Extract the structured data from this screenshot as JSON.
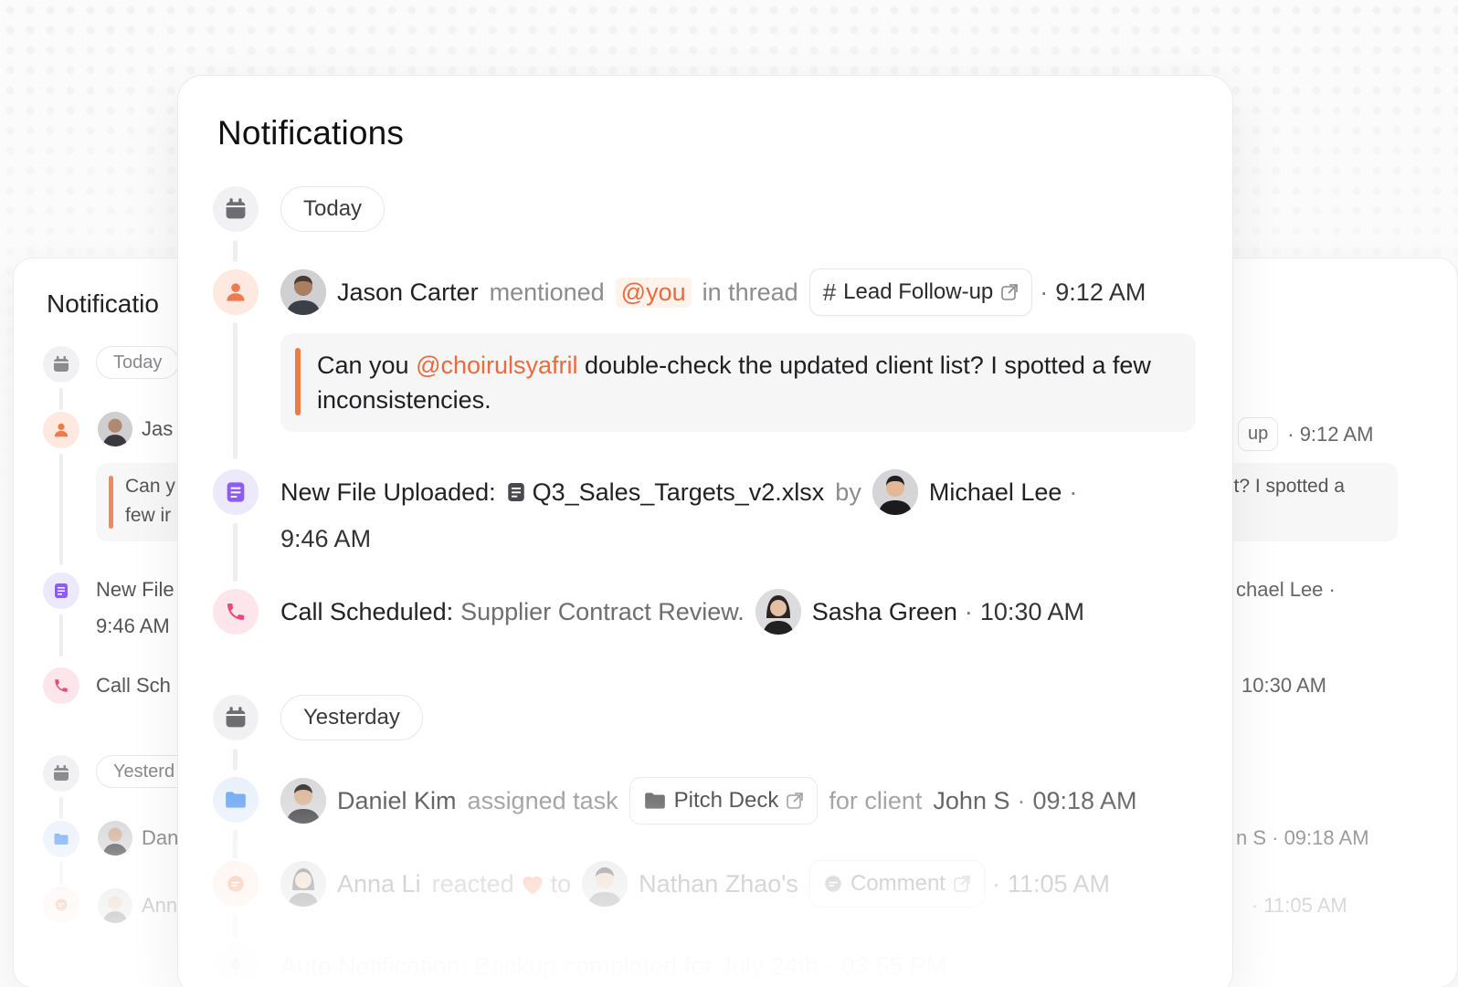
{
  "panel": {
    "title": "Notifications",
    "groups": [
      {
        "label": "Today"
      },
      {
        "label": "Yesterday"
      }
    ]
  },
  "notifications": {
    "mention": {
      "user": "Jason Carter",
      "action": "mentioned",
      "target": "@you",
      "context": "in thread",
      "tag": "Lead Follow-up",
      "time": "9:12 AM",
      "quote_prefix": "Can you ",
      "quote_mention": "@choirulsyafril",
      "quote_text": " double-check the updated client list? I spotted a few inconsistencies."
    },
    "file": {
      "label": "New File Uploaded:",
      "file_name": "Q3_Sales_Targets_v2.xlsx",
      "by": "by",
      "user": "Michael Lee",
      "time": "9:46 AM"
    },
    "call": {
      "label": "Call Scheduled:",
      "subject": "Supplier Contract Review.",
      "user": "Sasha Green",
      "time": "10:30 AM"
    },
    "task": {
      "user": "Daniel Kim",
      "action": "assigned task",
      "tag": "Pitch Deck",
      "for_client": "for client",
      "client": "John S",
      "time": "09:18 AM"
    },
    "reaction": {
      "user": "Anna Li",
      "action": "reacted",
      "to": "to",
      "target_user": "Nathan Zhao's",
      "tag": "Comment",
      "time": "11:05 AM"
    },
    "auto": {
      "label": "Auto Notification:",
      "text": "Backup completed for July 24th",
      "time": "03:55 PM"
    }
  },
  "back_panel": {
    "title": "Notificatio",
    "today": "Today",
    "yesterday": "Yesterd",
    "jason": "Jas",
    "quote_l1": "Can y",
    "quote_l2": "few ir",
    "file": "New File",
    "file_time": "9:46 AM",
    "call": "Call Sch",
    "daniel": "Dan",
    "anna": "Ann",
    "r_tag": "up",
    "r_time1": "· 9:12 AM",
    "r_quote": "st? I spotted a",
    "r_file": "chael Lee ·",
    "r_call": "10:30 AM",
    "r_task": "n S · 09:18 AM",
    "r_react": "· 11:05 AM"
  },
  "colors": {
    "accent_orange": "#ea6a3b",
    "file_purple": "#8b5cf6",
    "call_pink": "#e94a7f",
    "folder_blue": "#5b9cf0"
  }
}
